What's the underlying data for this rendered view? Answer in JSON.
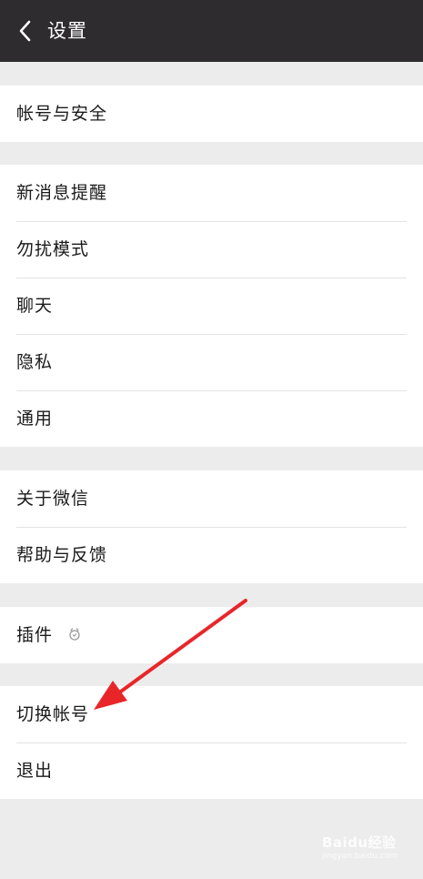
{
  "header": {
    "title": "设置",
    "back_icon": "chevron-left-icon"
  },
  "groups": [
    {
      "items": [
        {
          "label": "帐号与安全"
        }
      ]
    },
    {
      "items": [
        {
          "label": "新消息提醒"
        },
        {
          "label": "勿扰模式"
        },
        {
          "label": "聊天"
        },
        {
          "label": "隐私"
        },
        {
          "label": "通用"
        }
      ]
    },
    {
      "items": [
        {
          "label": "关于微信"
        },
        {
          "label": "帮助与反馈"
        }
      ]
    },
    {
      "items": [
        {
          "label": "插件",
          "icon": "plugin-icon"
        }
      ]
    },
    {
      "items": [
        {
          "label": "切换帐号"
        },
        {
          "label": "退出"
        }
      ]
    }
  ],
  "annotation": {
    "arrow_color": "#e8262a",
    "points_to": "切换帐号"
  },
  "watermark": {
    "text": "Baidu经验",
    "subtext": "jingyan.baidu.com"
  },
  "colors": {
    "header_bg": "#2e2c2f",
    "page_bg": "#ececec",
    "row_bg": "#ffffff"
  }
}
